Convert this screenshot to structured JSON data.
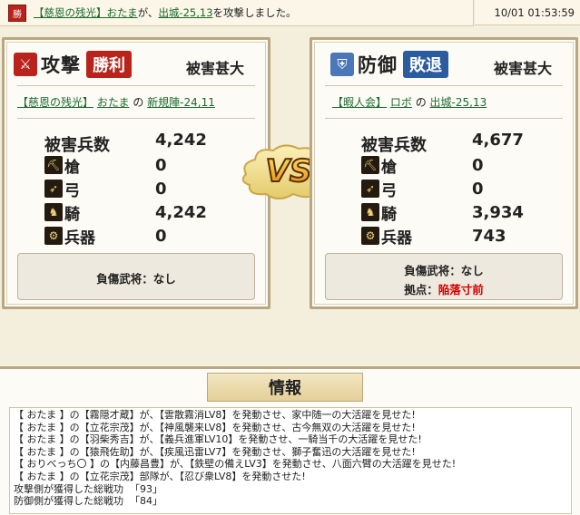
{
  "top": {
    "badge": "勝",
    "clan": "【慈恩の残光】",
    "player": "おたま",
    "mid": "が、",
    "target": "出城-25,13",
    "tail": "を攻撃しました。",
    "time": "10/01 01:53:59"
  },
  "attacker": {
    "side": "攻撃",
    "result": "勝利",
    "damage": "被害甚大",
    "clan": "【慈恩の残光】",
    "player": "おたま",
    "no": "の",
    "location": "新規陣-24,11",
    "total_label": "被害兵数",
    "total": "4,242",
    "rows": [
      {
        "icon": "spear-icon",
        "label": "槍",
        "value": "0"
      },
      {
        "icon": "bow-icon",
        "label": "弓",
        "value": "0"
      },
      {
        "icon": "horse-icon",
        "label": "騎",
        "value": "4,242"
      },
      {
        "icon": "siege-icon",
        "label": "兵器",
        "value": "0"
      }
    ],
    "general": "負傷武将：なし"
  },
  "defender": {
    "side": "防御",
    "result": "敗退",
    "damage": "被害甚大",
    "clan": "【暇人会】",
    "player": "ロボ",
    "no": "の",
    "location": "出城-25,13",
    "total_label": "被害兵数",
    "total": "4,677",
    "rows": [
      {
        "icon": "spear-icon",
        "label": "槍",
        "value": "0"
      },
      {
        "icon": "bow-icon",
        "label": "弓",
        "value": "0"
      },
      {
        "icon": "horse-icon",
        "label": "騎",
        "value": "3,934"
      },
      {
        "icon": "siege-icon",
        "label": "兵器",
        "value": "743"
      }
    ],
    "general": "負傷武将：なし",
    "base_label": "拠点：",
    "base_status": "陥落寸前"
  },
  "vs": "VS",
  "info": {
    "title": "情報",
    "lines": [
      "【 おたま 】の【霧隠才蔵】が、【雲散霧消LV8】を発動させ、家中随一の大活躍を見せた!",
      "【 おたま 】の【立花宗茂】が、【神風襲来LV8】を発動させ、古今無双の大活躍を見せた!",
      "【 おたま 】の【羽柴秀吉】が、【義兵進軍LV10】を発動させ、一騎当千の大活躍を見せた!",
      "【 おたま 】の【猿飛佐助】が、【疾風迅雷LV7】を発動させ、獅子奮迅の大活躍を見せた!",
      "【 おりべっち〇 】の【内藤昌豊】が、【鉄壁の備えLV3】を発動させ、八面六臂の大活躍を見せた!",
      "【 おたま 】の【立花宗茂】部隊が、【忍び衆LV8】を発動させた!"
    ],
    "atk_label": "攻撃側が獲得した総戦功",
    "atk_value": "「93」",
    "def_label": "防御側が獲得した総戦功",
    "def_value": "「84」"
  },
  "colors": {
    "win": "#b8241c",
    "lose": "#2a5c9e",
    "red_text": "#d40000"
  }
}
